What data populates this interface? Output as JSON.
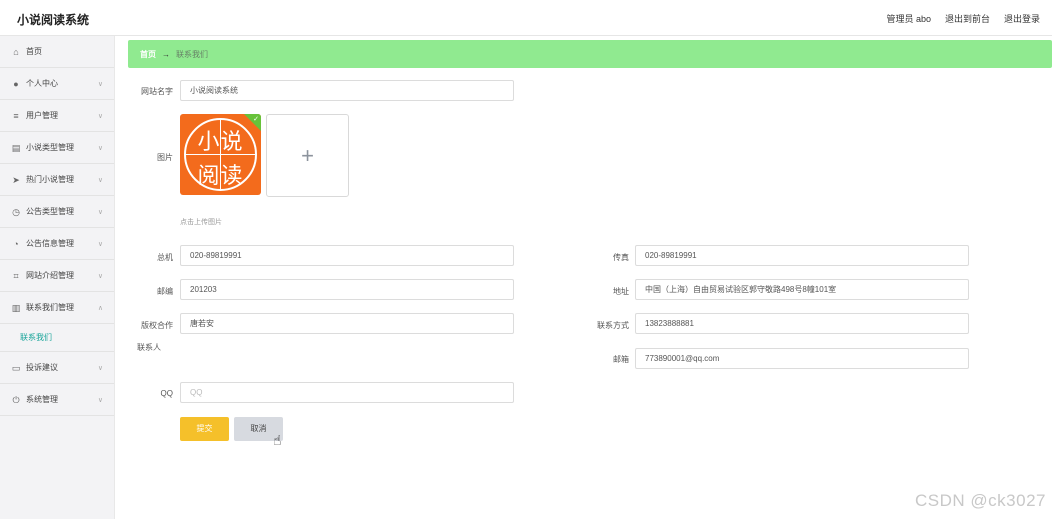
{
  "header": {
    "app_title": "小说阅读系统",
    "admin_label": "管理员 abo",
    "to_frontend": "退出到前台",
    "logout": "退出登录"
  },
  "sidebar": {
    "items": [
      {
        "label": "首页",
        "icon": "home-icon"
      },
      {
        "label": "个人中心",
        "icon": "user-icon"
      },
      {
        "label": "用户管理",
        "icon": "list-icon"
      },
      {
        "label": "小说类型管理",
        "icon": "book-icon"
      },
      {
        "label": "热门小说管理",
        "icon": "send-icon"
      },
      {
        "label": "公告类型管理",
        "icon": "clock-icon"
      },
      {
        "label": "公告信息管理",
        "icon": "gauge-icon"
      },
      {
        "label": "网站介绍管理",
        "icon": "crop-icon"
      },
      {
        "label": "联系我们管理",
        "icon": "trash-icon"
      }
    ],
    "sub_item": "联系我们",
    "items_after": [
      {
        "label": "投诉建议",
        "icon": "monitor-icon"
      },
      {
        "label": "系统管理",
        "icon": "power-icon"
      }
    ]
  },
  "breadcrumb": {
    "home": "首页",
    "separator": "→",
    "current": "联系我们"
  },
  "form": {
    "site_name_label": "网站名字",
    "site_name_value": "小说阅读系统",
    "image_label": "图片",
    "image_text_line1": "小说",
    "image_text_line2": "阅读",
    "upload_hint": "点击上传图片",
    "phone_label": "总机",
    "phone_value": "020-89819991",
    "fax_label": "传真",
    "fax_value": "020-89819991",
    "zip_label": "邮编",
    "zip_value": "201203",
    "address_label": "地址",
    "address_value": "中国（上海）自由贸易试验区郭守敬路498号8幢101室",
    "copyright_label_1": "版权合作",
    "copyright_label_2": "联系人",
    "copyright_value": "唐若安",
    "contact_label": "联系方式",
    "contact_value": "13823888881",
    "email_label": "邮箱",
    "email_value": "773890001@qq.com",
    "qq_label": "QQ",
    "qq_placeholder": "QQ",
    "submit_label": "提交",
    "cancel_label": "取消"
  },
  "watermark": "CSDN @ck3027",
  "colors": {
    "breadcrumb_bg": "#90ea90",
    "submit_bg": "#f5c02a",
    "cancel_bg": "#d7dae0",
    "active_sub": "#1aa59a",
    "logo_bg": "#f36b1c"
  }
}
